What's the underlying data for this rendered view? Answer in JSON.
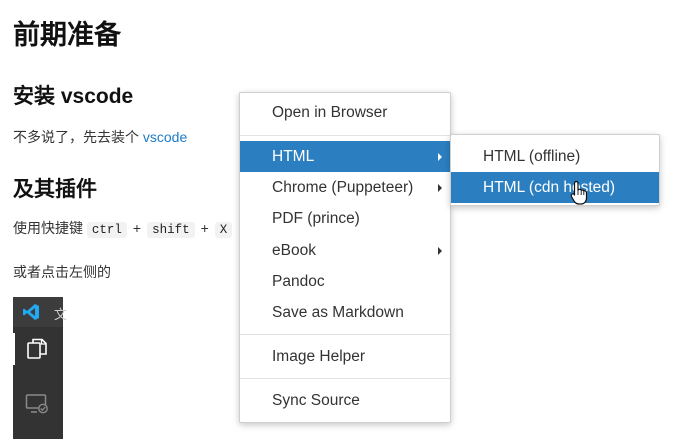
{
  "doc": {
    "title": "前期准备",
    "section1": "安装 vscode",
    "para1_text": "不多说了，先去装个",
    "para1_link": "vscode",
    "section2": "及其插件",
    "para2_prefix": "使用快捷键",
    "keys": [
      "ctrl",
      "shift",
      "X"
    ],
    "plus": "+",
    "para3": "或者点击左侧的",
    "vscode_title_char": "文"
  },
  "menu": {
    "items": [
      {
        "label": "Open in Browser"
      },
      {
        "label": "HTML",
        "submenu": true,
        "selected": true
      },
      {
        "label": "Chrome (Puppeteer)",
        "submenu": true
      },
      {
        "label": "PDF (prince)"
      },
      {
        "label": "eBook",
        "submenu": true
      },
      {
        "label": "Pandoc"
      },
      {
        "label": "Save as Markdown"
      },
      {
        "label": "Image Helper"
      },
      {
        "label": "Sync Source"
      }
    ]
  },
  "submenu": {
    "items": [
      {
        "label": "HTML (offline)"
      },
      {
        "label": "HTML (cdn hosted)",
        "selected": true
      }
    ]
  },
  "colors": {
    "selection": "#2b7fc0",
    "link": "#1e7bc8",
    "vscode_bar": "#333333"
  }
}
